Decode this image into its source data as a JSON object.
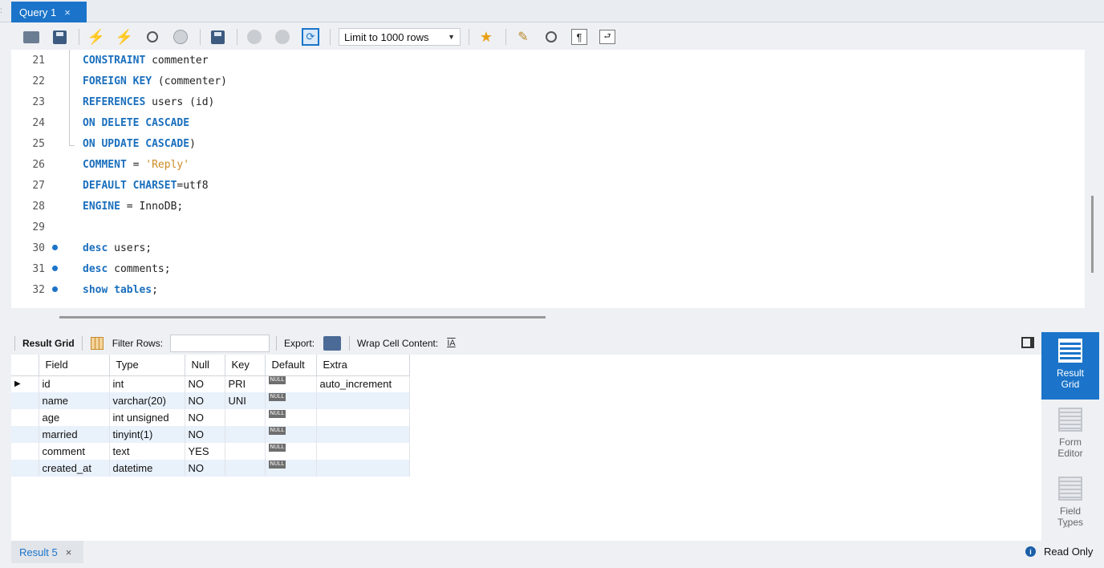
{
  "query_tab": {
    "label": "Query 1",
    "close": "×"
  },
  "toolbar": {
    "limit_select": "Limit to 1000 rows"
  },
  "editor": {
    "lines": [
      {
        "no": "21",
        "bullet": false,
        "tokens": [
          [
            "kw",
            "CONSTRAINT"
          ],
          [
            "plain",
            " commenter"
          ]
        ]
      },
      {
        "no": "22",
        "bullet": false,
        "tokens": [
          [
            "kw",
            "FOREIGN KEY"
          ],
          [
            "plain",
            " (commenter)"
          ]
        ]
      },
      {
        "no": "23",
        "bullet": false,
        "tokens": [
          [
            "kw",
            "REFERENCES"
          ],
          [
            "plain",
            " users (id)"
          ]
        ]
      },
      {
        "no": "24",
        "bullet": false,
        "tokens": [
          [
            "kw",
            "ON DELETE CASCADE"
          ]
        ]
      },
      {
        "no": "25",
        "bullet": false,
        "tokens": [
          [
            "kw",
            "ON UPDATE CASCADE"
          ],
          [
            "plain",
            ")"
          ]
        ]
      },
      {
        "no": "26",
        "bullet": false,
        "tokens": [
          [
            "kw",
            "COMMENT"
          ],
          [
            "plain",
            " = "
          ],
          [
            "str",
            "'Reply'"
          ]
        ]
      },
      {
        "no": "27",
        "bullet": false,
        "tokens": [
          [
            "kw",
            "DEFAULT CHARSET"
          ],
          [
            "plain",
            "=utf8"
          ]
        ]
      },
      {
        "no": "28",
        "bullet": false,
        "tokens": [
          [
            "kw",
            "ENGINE"
          ],
          [
            "plain",
            " = InnoDB;"
          ]
        ]
      },
      {
        "no": "29",
        "bullet": false,
        "tokens": []
      },
      {
        "no": "30",
        "bullet": true,
        "tokens": [
          [
            "kw",
            "desc"
          ],
          [
            "plain",
            " users;"
          ]
        ]
      },
      {
        "no": "31",
        "bullet": true,
        "tokens": [
          [
            "kw",
            "desc"
          ],
          [
            "plain",
            " comments;"
          ]
        ]
      },
      {
        "no": "32",
        "bullet": true,
        "tokens": [
          [
            "kw",
            "show"
          ],
          [
            "plain",
            " "
          ],
          [
            "kw",
            "tables"
          ],
          [
            "plain",
            ";"
          ]
        ]
      }
    ]
  },
  "result_toolbar": {
    "result_grid": "Result Grid",
    "filter_rows": "Filter Rows:",
    "filter_value": "",
    "export": "Export:",
    "wrap_cell": "Wrap Cell Content:",
    "wrap_icon_text": "IA"
  },
  "grid": {
    "columns": [
      "Field",
      "Type",
      "Null",
      "Key",
      "Default",
      "Extra"
    ],
    "null_badge": "NULL",
    "rows": [
      {
        "field": "id",
        "type": "int",
        "null": "NO",
        "key": "PRI",
        "extra": "auto_increment",
        "current": true
      },
      {
        "field": "name",
        "type": "varchar(20)",
        "null": "NO",
        "key": "UNI",
        "extra": "",
        "current": false
      },
      {
        "field": "age",
        "type": "int unsigned",
        "null": "NO",
        "key": "",
        "extra": "",
        "current": false
      },
      {
        "field": "married",
        "type": "tinyint(1)",
        "null": "NO",
        "key": "",
        "extra": "",
        "current": false
      },
      {
        "field": "comment",
        "type": "text",
        "null": "YES",
        "key": "",
        "extra": "",
        "current": false
      },
      {
        "field": "created_at",
        "type": "datetime",
        "null": "NO",
        "key": "",
        "extra": "",
        "current": false
      }
    ]
  },
  "side_panel": {
    "result_grid": [
      "Result",
      "Grid"
    ],
    "form_editor": [
      "Form",
      "Editor"
    ],
    "field_types": [
      "Field",
      "Types"
    ]
  },
  "bottom": {
    "result_tab": "Result 5",
    "result_close": "×",
    "read_only": "Read Only",
    "info_glyph": "i"
  },
  "colors": {
    "accent": "#1b74c9",
    "keyword": "#1a6fbd",
    "string": "#cb8b24"
  }
}
